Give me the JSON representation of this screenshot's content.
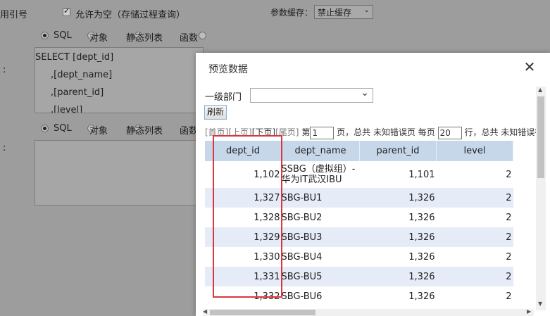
{
  "background": {
    "field_label_1": "用引号",
    "allow_empty": {
      "label": "允许为空（存储过程查询）",
      "checked": true
    },
    "param_cache": {
      "label": "参数缓存：",
      "value": "禁止缓存"
    },
    "source_options_1": [
      {
        "label": "SQL",
        "selected": true
      },
      {
        "label": "对象",
        "selected": false
      },
      {
        "label": "静态列表",
        "selected": false
      },
      {
        "label": "函数",
        "selected": false
      }
    ],
    "colon_1": ":",
    "sql_lines": [
      "SELECT  [dept_id]",
      ",[dept_name]",
      ",[parent_id]",
      ",[level]"
    ],
    "source_options_2": [
      {
        "label": "SQL",
        "selected": true
      },
      {
        "label": "对象",
        "selected": false
      },
      {
        "label": "静态列表",
        "selected": false
      },
      {
        "label": "函数",
        "selected": false
      }
    ],
    "colon_2": ":"
  },
  "dialog": {
    "title": "预览数据",
    "close_glyph": "✕",
    "filter_label": "一级部门",
    "filter_value": "",
    "refresh_label": "刷新",
    "pager": {
      "first": "[首页]",
      "prev": "[上页]",
      "next": "[下页]",
      "last": "[尾页]",
      "page_prefix": "第",
      "page_value": "1",
      "page_suffix": "页，总共 未知错误页 每页",
      "rows_value": "20",
      "rows_suffix": "行，总共 未知错误行"
    },
    "columns": [
      "dept_id",
      "dept_name",
      "parent_id",
      "level"
    ],
    "rows": [
      {
        "dept_id": "1,102",
        "dept_name_1": "SSBG（虚拟组）-",
        "dept_name_2": "华为IT武汉IBU",
        "parent_id": "1,101",
        "level": "2"
      },
      {
        "dept_id": "1,327",
        "dept_name_1": "SBG-BU1",
        "dept_name_2": "",
        "parent_id": "1,326",
        "level": "2"
      },
      {
        "dept_id": "1,328",
        "dept_name_1": "SBG-BU2",
        "dept_name_2": "",
        "parent_id": "1,326",
        "level": "2"
      },
      {
        "dept_id": "1,329",
        "dept_name_1": "SBG-BU3",
        "dept_name_2": "",
        "parent_id": "1,326",
        "level": "2"
      },
      {
        "dept_id": "1,330",
        "dept_name_1": "SBG-BU4",
        "dept_name_2": "",
        "parent_id": "1,326",
        "level": "2"
      },
      {
        "dept_id": "1,331",
        "dept_name_1": "SBG-BU5",
        "dept_name_2": "",
        "parent_id": "1,326",
        "level": "2"
      },
      {
        "dept_id": "1,332",
        "dept_name_1": "SBG-BU6",
        "dept_name_2": "",
        "parent_id": "1,326",
        "level": "2"
      }
    ],
    "highlight_color": "#d9363e"
  }
}
